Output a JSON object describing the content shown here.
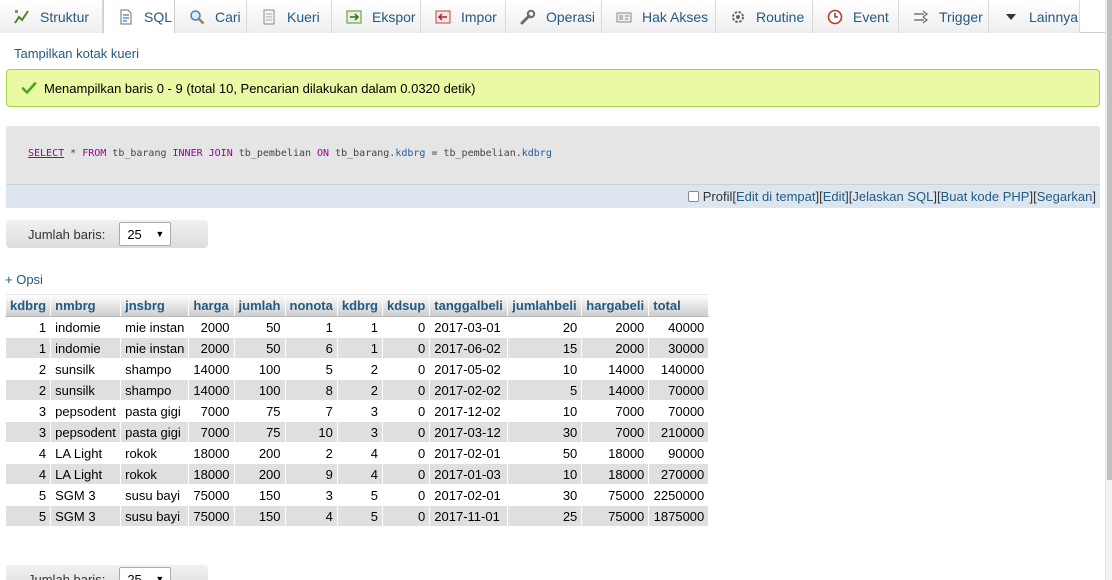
{
  "tabs": [
    {
      "label": "Struktur",
      "icon": "structure-icon"
    },
    {
      "label": "SQL",
      "icon": "sql-icon",
      "active": true
    },
    {
      "label": "Cari",
      "icon": "search-icon"
    },
    {
      "label": "Kueri",
      "icon": "query-icon"
    },
    {
      "label": "Ekspor",
      "icon": "export-icon"
    },
    {
      "label": "Impor",
      "icon": "import-icon"
    },
    {
      "label": "Operasi",
      "icon": "wrench-icon"
    },
    {
      "label": "Hak Akses",
      "icon": "privileges-icon"
    },
    {
      "label": "Routine",
      "icon": "routine-icon"
    },
    {
      "label": "Event",
      "icon": "clock-icon"
    },
    {
      "label": "Trigger",
      "icon": "trigger-icon"
    },
    {
      "label": "Lainnya",
      "icon": "triangle-down-icon"
    }
  ],
  "show_query_link": "Tampilkan kotak kueri",
  "success_message": "Menampilkan baris 0 - 9 (total 10, Pencarian dilakukan dalam 0.0320 detik)",
  "sql": {
    "tokens": [
      {
        "t": "SELECT",
        "c": "kw sel"
      },
      {
        "t": " * ",
        "c": ""
      },
      {
        "t": "FROM",
        "c": "kw"
      },
      {
        "t": " tb_barang ",
        "c": ""
      },
      {
        "t": "INNER JOIN",
        "c": "kw"
      },
      {
        "t": " tb_pembelian ",
        "c": ""
      },
      {
        "t": "ON",
        "c": "kw"
      },
      {
        "t": " tb_barang.",
        "c": ""
      },
      {
        "t": "kdbrg",
        "c": "col"
      },
      {
        "t": " = tb_pembelian.",
        "c": ""
      },
      {
        "t": "kdbrg",
        "c": "col"
      }
    ],
    "tools": {
      "profil": "Profil",
      "links": [
        "Edit di tempat",
        "Edit",
        "Jelaskan SQL",
        "Buat kode PHP",
        "Segarkan"
      ]
    }
  },
  "rows_label": "Jumlah baris:",
  "rows_value": "25",
  "options_link": "+ Opsi",
  "colors": {
    "accent": "#235a81",
    "success_bg": "#ebf8a4",
    "success_border": "#a2d246",
    "check": "#49a51e"
  },
  "table": {
    "columns": [
      "kdbrg",
      "nmbrg",
      "jnsbrg",
      "harga",
      "jumlah",
      "nonota",
      "kdbrg",
      "kdsup",
      "tanggalbeli",
      "jumlahbeli",
      "hargabeli",
      "total"
    ],
    "numeric": [
      true,
      false,
      false,
      true,
      true,
      true,
      true,
      true,
      false,
      true,
      true,
      true
    ],
    "rows": [
      [
        "1",
        "indomie",
        "mie instan",
        "2000",
        "50",
        "1",
        "1",
        "0",
        "2017-03-01",
        "20",
        "2000",
        "40000"
      ],
      [
        "1",
        "indomie",
        "mie instan",
        "2000",
        "50",
        "6",
        "1",
        "0",
        "2017-06-02",
        "15",
        "2000",
        "30000"
      ],
      [
        "2",
        "sunsilk",
        "shampo",
        "14000",
        "100",
        "5",
        "2",
        "0",
        "2017-05-02",
        "10",
        "14000",
        "140000"
      ],
      [
        "2",
        "sunsilk",
        "shampo",
        "14000",
        "100",
        "8",
        "2",
        "0",
        "2017-02-02",
        "5",
        "14000",
        "70000"
      ],
      [
        "3",
        "pepsodent",
        "pasta gigi",
        "7000",
        "75",
        "7",
        "3",
        "0",
        "2017-12-02",
        "10",
        "7000",
        "70000"
      ],
      [
        "3",
        "pepsodent",
        "pasta gigi",
        "7000",
        "75",
        "10",
        "3",
        "0",
        "2017-03-12",
        "30",
        "7000",
        "210000"
      ],
      [
        "4",
        "LA Light",
        "rokok",
        "18000",
        "200",
        "2",
        "4",
        "0",
        "2017-02-01",
        "50",
        "18000",
        "90000"
      ],
      [
        "4",
        "LA Light",
        "rokok",
        "18000",
        "200",
        "9",
        "4",
        "0",
        "2017-01-03",
        "10",
        "18000",
        "270000"
      ],
      [
        "5",
        "SGM 3",
        "susu bayi",
        "75000",
        "150",
        "3",
        "5",
        "0",
        "2017-02-01",
        "30",
        "75000",
        "2250000"
      ],
      [
        "5",
        "SGM 3",
        "susu bayi",
        "75000",
        "150",
        "4",
        "5",
        "0",
        "2017-11-01",
        "25",
        "75000",
        "1875000"
      ]
    ]
  }
}
